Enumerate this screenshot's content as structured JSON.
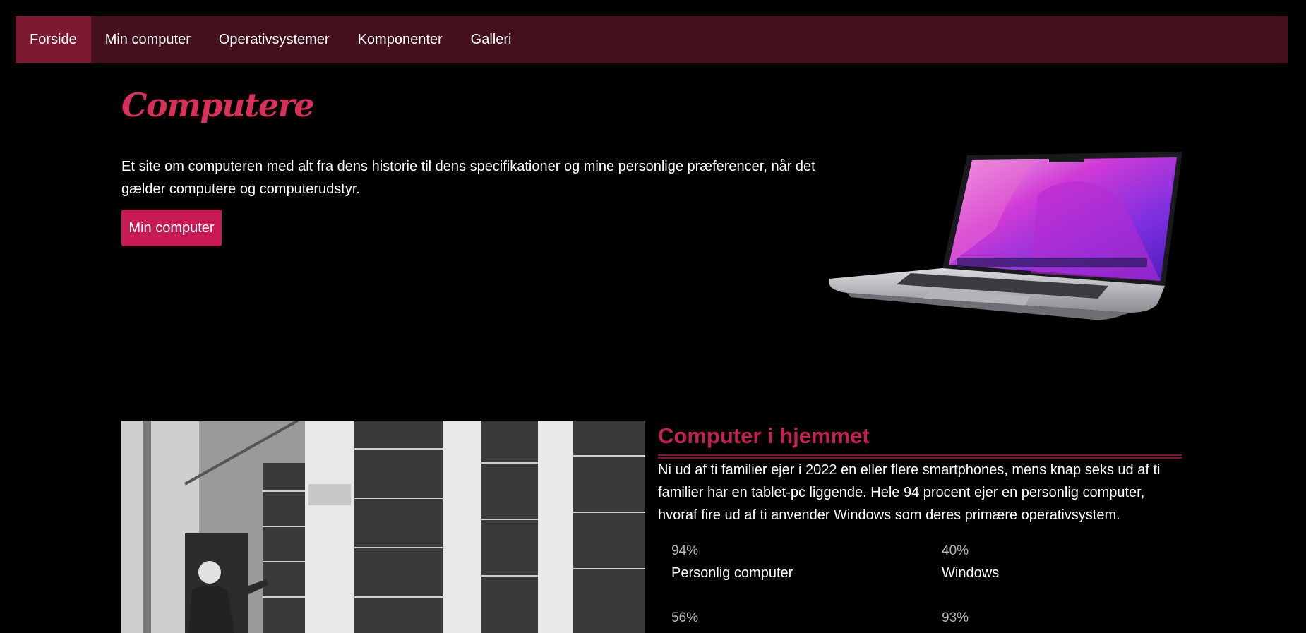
{
  "nav": {
    "items": [
      {
        "label": "Forside",
        "active": true
      },
      {
        "label": "Min computer"
      },
      {
        "label": "Operativsystemer"
      },
      {
        "label": "Komponenter"
      },
      {
        "label": "Galleri"
      }
    ]
  },
  "hero": {
    "title": "Computere",
    "text": "Et site om computeren med alt fra dens historie til dens specifikationer og mine personlige præferencer, når det gælder computere og computerudstyr.",
    "button_label": "Min computer"
  },
  "home": {
    "title": "Computer i hjemmet",
    "text": "Ni ud af ti familier ejer i 2022 en eller flere smartphones, mens knap seks ud af ti familier har en tablet-pc liggende. Hele 94 procent ejer en personlig computer, hvoraf fire ud af ti anvender Windows som deres primære operativsystem.",
    "stats": [
      {
        "value": "94%",
        "label": "Personlig computer"
      },
      {
        "value": "40%",
        "label": "Windows"
      },
      {
        "value": "56%",
        "label": ""
      },
      {
        "value": "93%",
        "label": ""
      }
    ]
  },
  "colors": {
    "nav_bg": "#43101c",
    "nav_active": "#7b1a30",
    "accent": "#d8305a",
    "button": "#c81a55"
  }
}
